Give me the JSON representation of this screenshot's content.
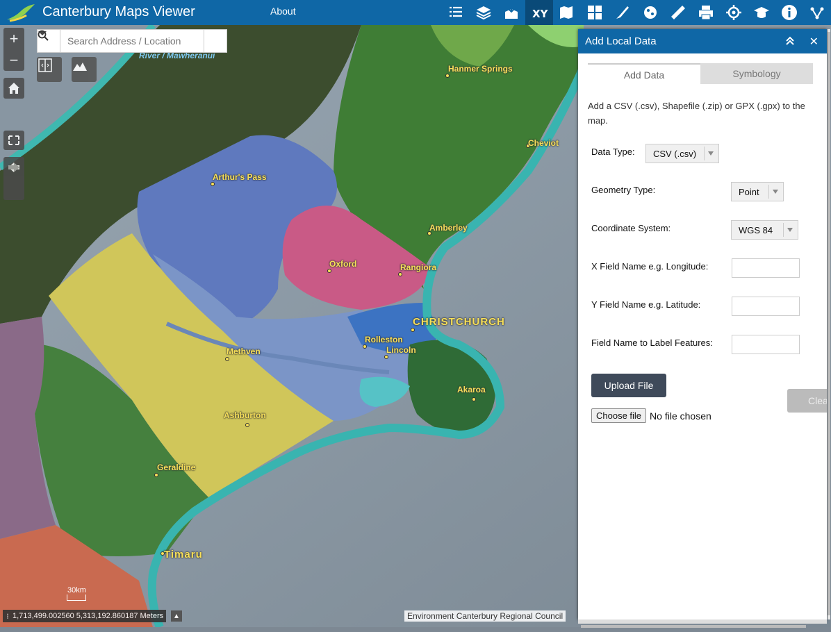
{
  "header": {
    "title": "Canterbury Maps Viewer",
    "about_label": "About",
    "tools": [
      "layer-list-icon",
      "basemap-icon",
      "add-data-icon",
      "xy-icon",
      "map-layers-icon",
      "widgets-icon",
      "draw-icon",
      "analysis-icon",
      "measure-icon",
      "print-icon",
      "locate-icon",
      "education-icon",
      "info-icon",
      "share-icon"
    ],
    "accent": "#0f67a6"
  },
  "search": {
    "placeholder": "Search Address / Location"
  },
  "map": {
    "zoom_in": "+",
    "zoom_out": "−",
    "river_label": "River / Mawheranui",
    "places": [
      {
        "name": "Hanmer Springs",
        "big": false
      },
      {
        "name": "Cheviot",
        "big": false
      },
      {
        "name": "Arthur's Pass",
        "big": false
      },
      {
        "name": "Amberley",
        "big": false
      },
      {
        "name": "Oxford",
        "big": false
      },
      {
        "name": "Rangiora",
        "big": false
      },
      {
        "name": "CHRISTCHURCH",
        "big": true
      },
      {
        "name": "Rolleston",
        "big": false
      },
      {
        "name": "Lincoln",
        "big": false
      },
      {
        "name": "Methven",
        "big": false
      },
      {
        "name": "Akaroa",
        "big": false
      },
      {
        "name": "Ashburton",
        "big": false
      },
      {
        "name": "Geraldine",
        "big": false
      },
      {
        "name": "Timaru",
        "big": true
      }
    ],
    "scale_label": "30km",
    "coordinates": "1,713,499.002560 5,313,192.860187 Meters",
    "attribution": "Environment Canterbury Regional Council"
  },
  "panel": {
    "title": "Add Local Data",
    "tabs": [
      "Add Data",
      "Symbology"
    ],
    "intro": "Add a CSV (.csv), Shapefile (.zip) or GPX (.gpx) to the map.",
    "data_type_label": "Data Type:",
    "data_type_value": "CSV (.csv)",
    "geometry_label": "Geometry Type:",
    "geometry_value": "Point",
    "coord_label": "Coordinate System:",
    "coord_value": "WGS 84",
    "x_label": "X Field Name e.g. Longitude:",
    "y_label": "Y Field Name e.g. Latitude:",
    "label_field_label": "Field Name to Label Features:",
    "upload_label": "Upload File",
    "clear_label": "Clear",
    "choose_file_label": "Choose file",
    "no_file_label": "No file chosen"
  }
}
